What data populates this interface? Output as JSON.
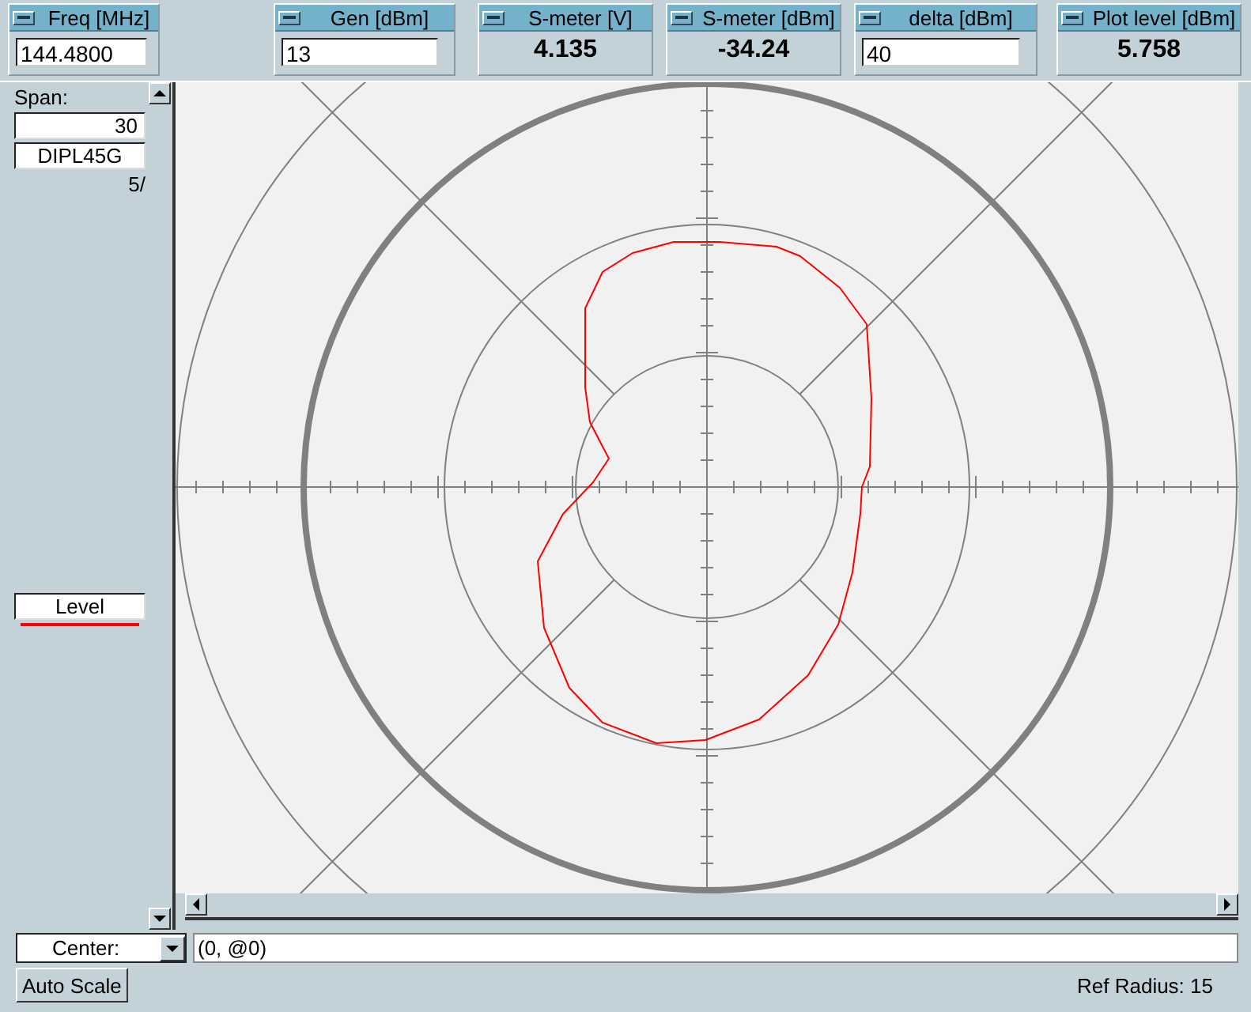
{
  "panels": [
    {
      "kind": "field",
      "title": "Freq [MHz]",
      "value": "144.4800"
    },
    {
      "kind": "field",
      "title": "Gen [dBm]",
      "value": "13"
    },
    {
      "kind": "readout",
      "title": "S-meter [V]",
      "value": "4.135"
    },
    {
      "kind": "readout",
      "title": "S-meter [dBm]",
      "value": "-34.24"
    },
    {
      "kind": "field",
      "title": "delta [dBm]",
      "value": "40"
    },
    {
      "kind": "readout",
      "title": "Plot level [dBm]",
      "value": "5.758"
    }
  ],
  "sidebar": {
    "span_label": "Span:",
    "span_value": "30",
    "name": "DIPL45G",
    "note": "5/",
    "trace": {
      "label": "Level",
      "color": "#ff0000"
    }
  },
  "bottom": {
    "mode": "Center:",
    "value": "(0, @0)",
    "button": "Auto Scale",
    "ref_radius": "Ref Radius: 15"
  }
}
